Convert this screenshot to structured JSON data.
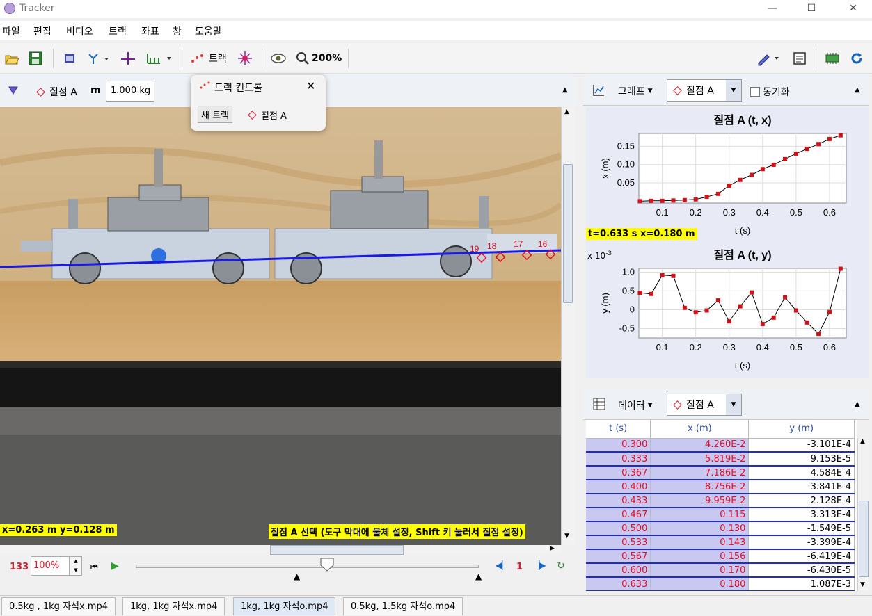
{
  "window": {
    "title": "Tracker",
    "minimize": "—",
    "maximize": "☐",
    "close": "✕"
  },
  "menu": [
    "파일",
    "편집",
    "비디오",
    "트랙",
    "좌표",
    "창",
    "도움말"
  ],
  "toolbar": {
    "track_label": "트랙",
    "zoom_label": "200%"
  },
  "trackbar": {
    "track_name": "질점 A",
    "mass_label": "m",
    "mass_value": "1.000 kg"
  },
  "track_popup": {
    "title": "트랙 컨트롤",
    "new_track": "새 트랙",
    "track_item": "질점 A"
  },
  "video": {
    "coord_readout": "x=0.263 m  y=0.128 m",
    "hint": "질점 A 선택 (도구 막대에 물체 설정, Shift 키 눌러서 질점 설정)",
    "point_labels": [
      "19",
      "18",
      "17",
      "16"
    ]
  },
  "player": {
    "frame": "133",
    "zoom": "100%",
    "step": "1"
  },
  "graph_panel": {
    "view_label": "그래프",
    "track_label": "질점 A",
    "sync_label": "동기화",
    "readout": "t=0.633 s  x=0.180 m",
    "exponent_label": "x 10",
    "exponent_power": "-3"
  },
  "data_panel": {
    "view_label": "데이터",
    "track_label": "질점 A",
    "columns": [
      "t (s)",
      "x (m)",
      "y (m)"
    ],
    "rows": [
      [
        "0.300",
        "4.260E-2",
        "-3.101E-4"
      ],
      [
        "0.333",
        "5.819E-2",
        "9.153E-5"
      ],
      [
        "0.367",
        "7.186E-2",
        "4.584E-4"
      ],
      [
        "0.400",
        "8.756E-2",
        "-3.841E-4"
      ],
      [
        "0.433",
        "9.959E-2",
        "-2.128E-4"
      ],
      [
        "0.467",
        "0.115",
        "3.313E-4"
      ],
      [
        "0.500",
        "0.130",
        "-1.549E-5"
      ],
      [
        "0.533",
        "0.143",
        "-3.399E-4"
      ],
      [
        "0.567",
        "0.156",
        "-6.419E-4"
      ],
      [
        "0.600",
        "0.170",
        "-6.430E-5"
      ],
      [
        "0.633",
        "0.180",
        "1.087E-3"
      ]
    ]
  },
  "file_tabs": [
    "0.5kg , 1kg 자석x.mp4",
    "1kg, 1kg 자석x.mp4",
    "1kg, 1kg 자석o.mp4",
    "0.5kg, 1.5kg 자석o.mp4"
  ],
  "chart_data": [
    {
      "type": "line",
      "title": "질점 A (t, x)",
      "xlabel": "t (s)",
      "ylabel": "x (m)",
      "xlim": [
        0.03,
        0.65
      ],
      "ylim": [
        -0.005,
        0.185
      ],
      "xticks": [
        "0.1",
        "0.2",
        "0.3",
        "0.4",
        "0.5",
        "0.6"
      ],
      "yticks": [
        "0.05",
        "0.10",
        "0.15"
      ],
      "grid": true,
      "x": [
        0.033,
        0.067,
        0.1,
        0.133,
        0.167,
        0.2,
        0.233,
        0.267,
        0.3,
        0.333,
        0.367,
        0.4,
        0.433,
        0.467,
        0.5,
        0.533,
        0.567,
        0.6,
        0.633
      ],
      "y": [
        0.0,
        0.001,
        0.001,
        0.002,
        0.003,
        0.005,
        0.012,
        0.02,
        0.0426,
        0.0582,
        0.0719,
        0.0876,
        0.0996,
        0.115,
        0.13,
        0.143,
        0.156,
        0.17,
        0.18
      ]
    },
    {
      "type": "line",
      "title": "질점 A (t, y)",
      "xlabel": "t (s)",
      "ylabel": "y (m)",
      "xlim": [
        0.03,
        0.65
      ],
      "ylim": [
        -0.75,
        1.1
      ],
      "xticks": [
        "0.1",
        "0.2",
        "0.3",
        "0.4",
        "0.5",
        "0.6"
      ],
      "yticks": [
        "1.0",
        "0.5",
        "0",
        "-0.5"
      ],
      "grid": true,
      "x": [
        0.033,
        0.067,
        0.1,
        0.133,
        0.167,
        0.2,
        0.233,
        0.267,
        0.3,
        0.333,
        0.367,
        0.4,
        0.433,
        0.467,
        0.5,
        0.533,
        0.567,
        0.6,
        0.633
      ],
      "y": [
        0.45,
        0.42,
        0.92,
        0.9,
        0.05,
        -0.07,
        -0.02,
        0.25,
        -0.31,
        0.09,
        0.46,
        -0.38,
        -0.21,
        0.33,
        -0.02,
        -0.34,
        -0.64,
        -0.06,
        1.09
      ]
    }
  ]
}
